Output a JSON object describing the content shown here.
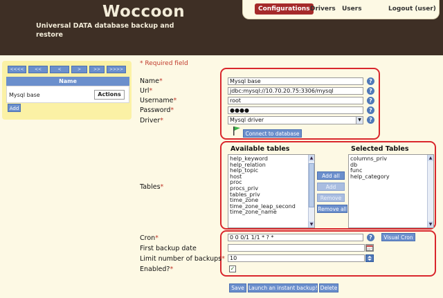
{
  "header": {
    "logo": "Woccoon",
    "tagline": "Universal DATA database backup and restore"
  },
  "nav": {
    "configurations": "Configurations",
    "drivers": "Drivers",
    "users": "Users",
    "logout": "Logout (user)"
  },
  "pager": {
    "first": "<<<<",
    "prev_many": "<<",
    "prev": "<",
    "next": ">",
    "next_many": ">>",
    "last": ">>>>"
  },
  "list": {
    "header": "Name",
    "rows": [
      {
        "name": "Mysql base",
        "action_label": "Actions"
      }
    ],
    "add_label": "Add"
  },
  "form": {
    "required_note": "* Required field",
    "name": {
      "label": "Name",
      "value": "Mysql base"
    },
    "url": {
      "label": "Url",
      "value": "jdbc:mysql://10.70.20.75:3306/mysql"
    },
    "username": {
      "label": "Username",
      "value": "root"
    },
    "password": {
      "label": "Password",
      "value": "●●●●"
    },
    "driver": {
      "label": "Driver",
      "value": "Mysql driver"
    },
    "connect_label": "Connect to database",
    "tables": {
      "label": "Tables",
      "available_header": "Available tables",
      "selected_header": "Selected Tables",
      "available": [
        "help_keyword",
        "help_relation",
        "help_topic",
        "host",
        "proc",
        "procs_priv",
        "tables_priv",
        "time_zone",
        "time_zone_leap_second",
        "time_zone_name"
      ],
      "selected": [
        "columns_priv",
        "db",
        "func",
        "help_category"
      ],
      "add_all": "Add all",
      "add": "Add",
      "remove": "Remove",
      "remove_all": "Remove all"
    },
    "cron": {
      "label": "Cron",
      "value": "0 0 0/1 1/1 * ? *",
      "visual_label": "Visual Cron"
    },
    "first_backup": {
      "label": "First backup date",
      "value": ""
    },
    "limit_backups": {
      "label": "Limit number of backups",
      "value": "10"
    },
    "enabled": {
      "label": "Enabled?",
      "checked": true
    },
    "required_mark": "*",
    "help_glyph": "?",
    "checkmark": "✓",
    "buttons": {
      "save": "Save",
      "instant_backup": "Launch an instant backup!",
      "delete": "Delete"
    }
  },
  "colors": {
    "header_bg": "#3e2f25",
    "page_bg": "#fdf9e4",
    "accent_red": "#d9262c",
    "nav_active": "#a52a2a",
    "button_blue": "#6b8fcc",
    "panel_yellow": "#fbf1a5"
  }
}
